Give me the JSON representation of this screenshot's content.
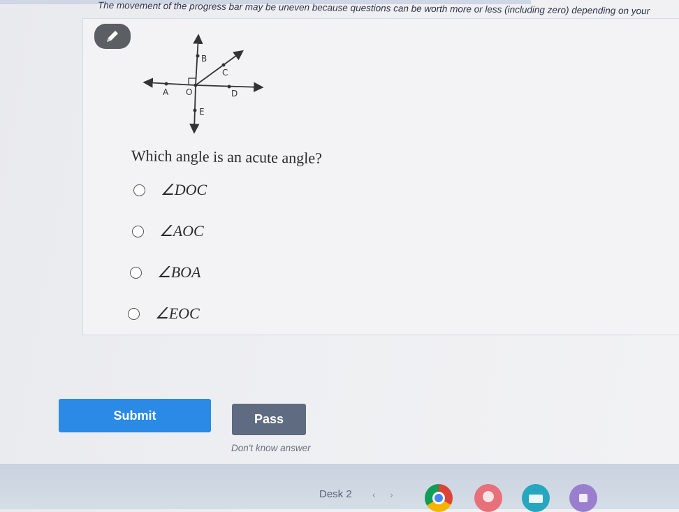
{
  "notice": {
    "text": "The movement of the progress bar may be uneven because questions can be worth more or less (including zero) depending on your"
  },
  "tool": {
    "icon": "pencil-icon"
  },
  "diagram": {
    "labels": {
      "a": "A",
      "o": "O",
      "b": "B",
      "c": "C",
      "d": "D",
      "e": "E"
    }
  },
  "question": {
    "text": "Which angle is an acute angle?",
    "options": [
      {
        "label": "∠DOC"
      },
      {
        "label": "∠AOC"
      },
      {
        "label": "∠BOA"
      },
      {
        "label": "∠EOC"
      }
    ]
  },
  "actions": {
    "submit_label": "Submit",
    "pass_label": "Pass",
    "dont_know_label": "Don't know answer"
  },
  "taskbar": {
    "desk_label": "Desk 2",
    "prev_icon": "chevron-left-icon",
    "next_icon": "chevron-right-icon",
    "apps": [
      "chrome-icon",
      "paint-icon",
      "classroom-icon",
      "app-icon"
    ]
  },
  "colors": {
    "submit": "#2a8ae6",
    "pass": "#5e6b80",
    "pencil_button": "#5b5f63"
  }
}
